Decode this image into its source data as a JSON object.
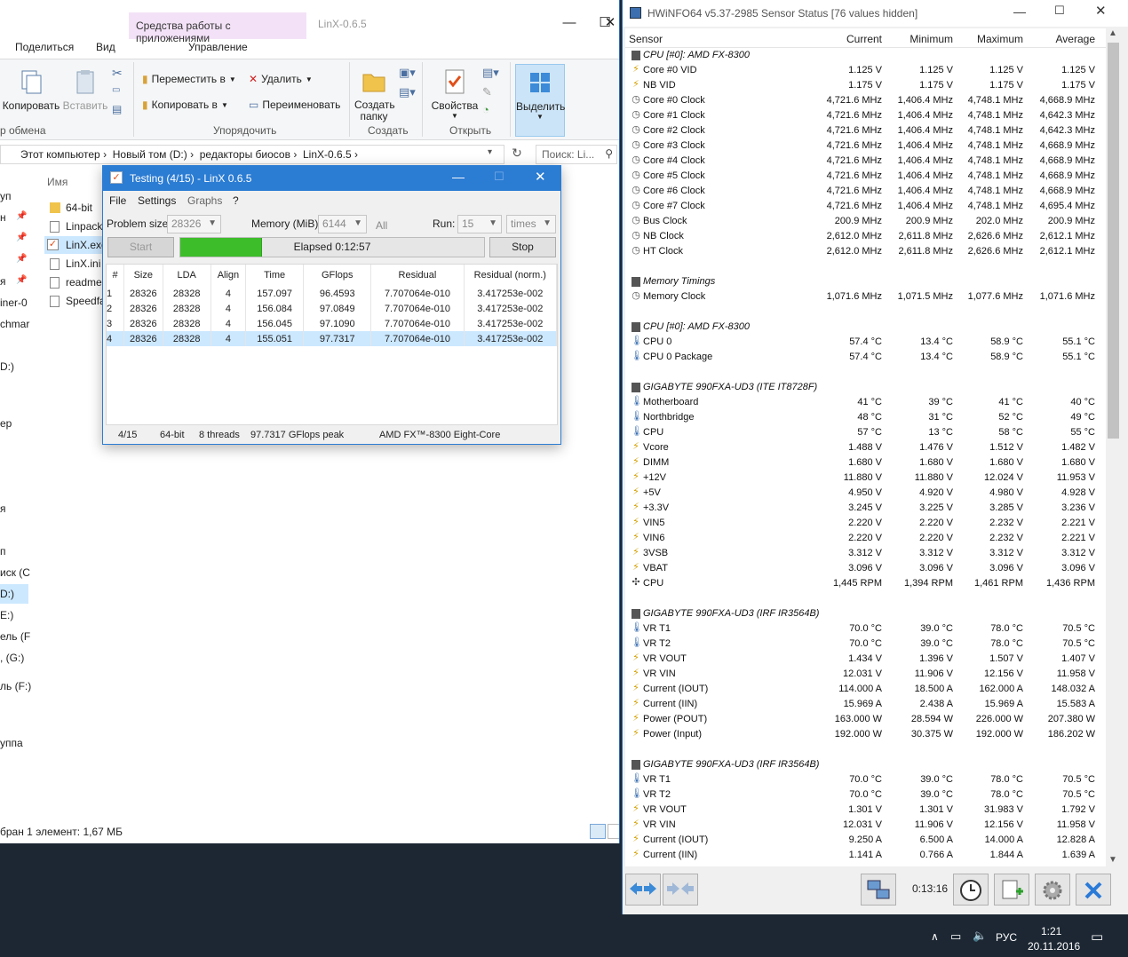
{
  "explorer": {
    "context_tab": "Средства работы с приложениями",
    "window_title": "LinX-0.6.5",
    "tabs": [
      "Поделиться",
      "Вид",
      "Управление"
    ],
    "ribbon": {
      "copy": "Копировать",
      "paste": "Вставить",
      "move_to": "Переместить в",
      "copy_to": "Копировать в",
      "delete": "Удалить",
      "rename": "Переименовать",
      "new_folder": "Создать папку",
      "properties": "Свойства",
      "select": "Выделить",
      "groups": [
        "р обмена",
        "Упорядочить",
        "Создать",
        "Открыть"
      ]
    },
    "breadcrumb": [
      "Этот компьютер",
      "Новый том (D:)",
      "редакторы биосов",
      "LinX-0.6.5"
    ],
    "search_placeholder": "Поиск: Li...",
    "column_name": "Имя",
    "nav_items": [
      "уп",
      "н",
      "",
      "",
      "я",
      "iner-0",
      "chmar",
      "D:)",
      "ер",
      "я",
      "п",
      "иск (C",
      "D:)",
      "E:)",
      "ель (F",
      ", (G:)",
      "ль (F:)",
      "уппа"
    ],
    "files": [
      "64-bit",
      "Linpack",
      "LinX.exe",
      "LinX.ini",
      "readme",
      "Speedfa"
    ],
    "status": "бран 1 элемент: 1,67 МБ"
  },
  "linx": {
    "title": "Testing (4/15) - LinX 0.6.5",
    "menu": [
      "File",
      "Settings",
      "Graphs",
      "?"
    ],
    "problem_size_label": "Problem size:",
    "problem_size": "28326",
    "memory_label": "Memory (MiB):",
    "memory": "6144",
    "all_label": "All",
    "run_label": "Run:",
    "run": "15",
    "times": "times",
    "start": "Start",
    "stop": "Stop",
    "elapsed": "Elapsed 0:12:57",
    "progress": 0.27,
    "columns": [
      "#",
      "Size",
      "LDA",
      "Align",
      "Time",
      "GFlops",
      "Residual",
      "Residual (norm.)"
    ],
    "rows": [
      [
        "1",
        "28326",
        "28328",
        "4",
        "157.097",
        "96.4593",
        "7.707064e-010",
        "3.417253e-002"
      ],
      [
        "2",
        "28326",
        "28328",
        "4",
        "156.084",
        "97.0849",
        "7.707064e-010",
        "3.417253e-002"
      ],
      [
        "3",
        "28326",
        "28328",
        "4",
        "156.045",
        "97.1090",
        "7.707064e-010",
        "3.417253e-002"
      ],
      [
        "4",
        "28326",
        "28328",
        "4",
        "155.051",
        "97.7317",
        "7.707064e-010",
        "3.417253e-002"
      ]
    ],
    "status": [
      "4/15",
      "64-bit",
      "8 threads",
      "97.7317 GFlops peak",
      "AMD FX™-8300 Eight-Core"
    ]
  },
  "hwinfo": {
    "title": "HWiNFO64 v5.37-2985 Sensor Status [76 values hidden]",
    "headers": [
      "Sensor",
      "Current",
      "Minimum",
      "Maximum",
      "Average"
    ],
    "rows": [
      {
        "t": "g",
        "n": "CPU [#0]: AMD FX-8300"
      },
      {
        "t": "v",
        "n": "Core #0 VID",
        "v": [
          "1.125 V",
          "1.125 V",
          "1.125 V",
          "1.125 V"
        ]
      },
      {
        "t": "v",
        "n": "NB VID",
        "v": [
          "1.175 V",
          "1.175 V",
          "1.175 V",
          "1.175 V"
        ]
      },
      {
        "t": "c",
        "n": "Core #0 Clock",
        "v": [
          "4,721.6 MHz",
          "1,406.4 MHz",
          "4,748.1 MHz",
          "4,668.9 MHz"
        ]
      },
      {
        "t": "c",
        "n": "Core #1 Clock",
        "v": [
          "4,721.6 MHz",
          "1,406.4 MHz",
          "4,748.1 MHz",
          "4,642.3 MHz"
        ]
      },
      {
        "t": "c",
        "n": "Core #2 Clock",
        "v": [
          "4,721.6 MHz",
          "1,406.4 MHz",
          "4,748.1 MHz",
          "4,642.3 MHz"
        ]
      },
      {
        "t": "c",
        "n": "Core #3 Clock",
        "v": [
          "4,721.6 MHz",
          "1,406.4 MHz",
          "4,748.1 MHz",
          "4,668.9 MHz"
        ]
      },
      {
        "t": "c",
        "n": "Core #4 Clock",
        "v": [
          "4,721.6 MHz",
          "1,406.4 MHz",
          "4,748.1 MHz",
          "4,668.9 MHz"
        ]
      },
      {
        "t": "c",
        "n": "Core #5 Clock",
        "v": [
          "4,721.6 MHz",
          "1,406.4 MHz",
          "4,748.1 MHz",
          "4,668.9 MHz"
        ]
      },
      {
        "t": "c",
        "n": "Core #6 Clock",
        "v": [
          "4,721.6 MHz",
          "1,406.4 MHz",
          "4,748.1 MHz",
          "4,668.9 MHz"
        ]
      },
      {
        "t": "c",
        "n": "Core #7 Clock",
        "v": [
          "4,721.6 MHz",
          "1,406.4 MHz",
          "4,748.1 MHz",
          "4,695.4 MHz"
        ]
      },
      {
        "t": "c",
        "n": "Bus Clock",
        "v": [
          "200.9 MHz",
          "200.9 MHz",
          "202.0 MHz",
          "200.9 MHz"
        ]
      },
      {
        "t": "c",
        "n": "NB Clock",
        "v": [
          "2,612.0 MHz",
          "2,611.8 MHz",
          "2,626.6 MHz",
          "2,612.1 MHz"
        ]
      },
      {
        "t": "c",
        "n": "HT Clock",
        "v": [
          "2,612.0 MHz",
          "2,611.8 MHz",
          "2,626.6 MHz",
          "2,612.1 MHz"
        ]
      },
      {
        "t": "e"
      },
      {
        "t": "g",
        "n": "Memory Timings"
      },
      {
        "t": "c",
        "n": "Memory Clock",
        "v": [
          "1,071.6 MHz",
          "1,071.5 MHz",
          "1,077.6 MHz",
          "1,071.6 MHz"
        ]
      },
      {
        "t": "e"
      },
      {
        "t": "g",
        "n": "CPU [#0]: AMD FX-8300"
      },
      {
        "t": "t",
        "n": "CPU 0",
        "v": [
          "57.4 °C",
          "13.4 °C",
          "58.9 °C",
          "55.1 °C"
        ]
      },
      {
        "t": "t",
        "n": "CPU 0 Package",
        "v": [
          "57.4 °C",
          "13.4 °C",
          "58.9 °C",
          "55.1 °C"
        ]
      },
      {
        "t": "e"
      },
      {
        "t": "g",
        "n": "GIGABYTE 990FXA-UD3 (ITE IT8728F)"
      },
      {
        "t": "t",
        "n": "Motherboard",
        "v": [
          "41 °C",
          "39 °C",
          "41 °C",
          "40 °C"
        ]
      },
      {
        "t": "t",
        "n": "Northbridge",
        "v": [
          "48 °C",
          "31 °C",
          "52 °C",
          "49 °C"
        ]
      },
      {
        "t": "t",
        "n": "CPU",
        "v": [
          "57 °C",
          "13 °C",
          "58 °C",
          "55 °C"
        ]
      },
      {
        "t": "v",
        "n": "Vcore",
        "v": [
          "1.488 V",
          "1.476 V",
          "1.512 V",
          "1.482 V"
        ]
      },
      {
        "t": "v",
        "n": "DIMM",
        "v": [
          "1.680 V",
          "1.680 V",
          "1.680 V",
          "1.680 V"
        ]
      },
      {
        "t": "v",
        "n": "+12V",
        "v": [
          "11.880 V",
          "11.880 V",
          "12.024 V",
          "11.953 V"
        ]
      },
      {
        "t": "v",
        "n": "+5V",
        "v": [
          "4.950 V",
          "4.920 V",
          "4.980 V",
          "4.928 V"
        ]
      },
      {
        "t": "v",
        "n": "+3.3V",
        "v": [
          "3.245 V",
          "3.225 V",
          "3.285 V",
          "3.236 V"
        ]
      },
      {
        "t": "v",
        "n": "VIN5",
        "v": [
          "2.220 V",
          "2.220 V",
          "2.232 V",
          "2.221 V"
        ]
      },
      {
        "t": "v",
        "n": "VIN6",
        "v": [
          "2.220 V",
          "2.220 V",
          "2.232 V",
          "2.221 V"
        ]
      },
      {
        "t": "v",
        "n": "3VSB",
        "v": [
          "3.312 V",
          "3.312 V",
          "3.312 V",
          "3.312 V"
        ]
      },
      {
        "t": "v",
        "n": "VBAT",
        "v": [
          "3.096 V",
          "3.096 V",
          "3.096 V",
          "3.096 V"
        ]
      },
      {
        "t": "f",
        "n": "CPU",
        "v": [
          "1,445 RPM",
          "1,394 RPM",
          "1,461 RPM",
          "1,436 RPM"
        ]
      },
      {
        "t": "e"
      },
      {
        "t": "g",
        "n": "GIGABYTE 990FXA-UD3 (IRF IR3564B)"
      },
      {
        "t": "t",
        "n": "VR T1",
        "v": [
          "70.0 °C",
          "39.0 °C",
          "78.0 °C",
          "70.5 °C"
        ]
      },
      {
        "t": "t",
        "n": "VR T2",
        "v": [
          "70.0 °C",
          "39.0 °C",
          "78.0 °C",
          "70.5 °C"
        ]
      },
      {
        "t": "v",
        "n": "VR VOUT",
        "v": [
          "1.434 V",
          "1.396 V",
          "1.507 V",
          "1.407 V"
        ]
      },
      {
        "t": "v",
        "n": "VR VIN",
        "v": [
          "12.031 V",
          "11.906 V",
          "12.156 V",
          "11.958 V"
        ]
      },
      {
        "t": "v",
        "n": "Current (IOUT)",
        "v": [
          "114.000 A",
          "18.500 A",
          "162.000 A",
          "148.032 A"
        ]
      },
      {
        "t": "v",
        "n": "Current (IIN)",
        "v": [
          "15.969 A",
          "2.438 A",
          "15.969 A",
          "15.583 A"
        ]
      },
      {
        "t": "v",
        "n": "Power (POUT)",
        "v": [
          "163.000 W",
          "28.594 W",
          "226.000 W",
          "207.380 W"
        ]
      },
      {
        "t": "v",
        "n": "Power (Input)",
        "v": [
          "192.000 W",
          "30.375 W",
          "192.000 W",
          "186.202 W"
        ]
      },
      {
        "t": "e"
      },
      {
        "t": "g",
        "n": "GIGABYTE 990FXA-UD3 (IRF IR3564B)"
      },
      {
        "t": "t",
        "n": "VR T1",
        "v": [
          "70.0 °C",
          "39.0 °C",
          "78.0 °C",
          "70.5 °C"
        ]
      },
      {
        "t": "t",
        "n": "VR T2",
        "v": [
          "70.0 °C",
          "39.0 °C",
          "78.0 °C",
          "70.5 °C"
        ]
      },
      {
        "t": "v",
        "n": "VR VOUT",
        "v": [
          "1.301 V",
          "1.301 V",
          "31.983 V",
          "1.792 V"
        ]
      },
      {
        "t": "v",
        "n": "VR VIN",
        "v": [
          "12.031 V",
          "11.906 V",
          "12.156 V",
          "11.958 V"
        ]
      },
      {
        "t": "v",
        "n": "Current (IOUT)",
        "v": [
          "9.250 A",
          "6.500 A",
          "14.000 A",
          "12.828 A"
        ]
      },
      {
        "t": "v",
        "n": "Current (IIN)",
        "v": [
          "1.141 A",
          "0.766 A",
          "1.844 A",
          "1.639 A"
        ]
      }
    ],
    "timer": "0:13:16"
  },
  "taskbar": {
    "lang": "РУС",
    "time": "1:21",
    "date": "20.11.2016"
  }
}
